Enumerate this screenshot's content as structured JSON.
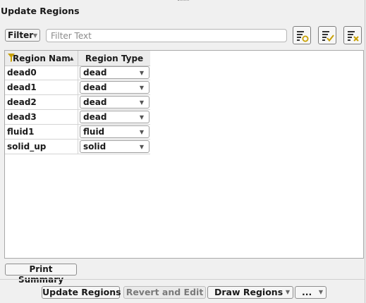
{
  "panel": {
    "title": "Update Regions"
  },
  "filter": {
    "button_label": "Filter",
    "placeholder": "Filter Text"
  },
  "toolbar": [
    {
      "name": "select-filtered-button",
      "icon": "list-circle-icon"
    },
    {
      "name": "select-all-button",
      "icon": "list-check-icon"
    },
    {
      "name": "deselect-all-button",
      "icon": "list-x-icon"
    }
  ],
  "table": {
    "columns": [
      "Region Nam",
      "Region Type"
    ],
    "rows": [
      {
        "name": "dead0",
        "type": "dead"
      },
      {
        "name": "dead1",
        "type": "dead"
      },
      {
        "name": "dead2",
        "type": "dead"
      },
      {
        "name": "dead3",
        "type": "dead"
      },
      {
        "name": "fluid1",
        "type": "fluid"
      },
      {
        "name": "solid_up",
        "type": "solid"
      }
    ]
  },
  "print_summary_label": "Print Summary",
  "footer": {
    "update_label": "Update Regions",
    "revert_label": "Revert and Edit",
    "draw_label": "Draw Regions",
    "more_label": "..."
  },
  "colors": {
    "accent_icon": "#c8a000",
    "border": "#8e8e8e"
  }
}
